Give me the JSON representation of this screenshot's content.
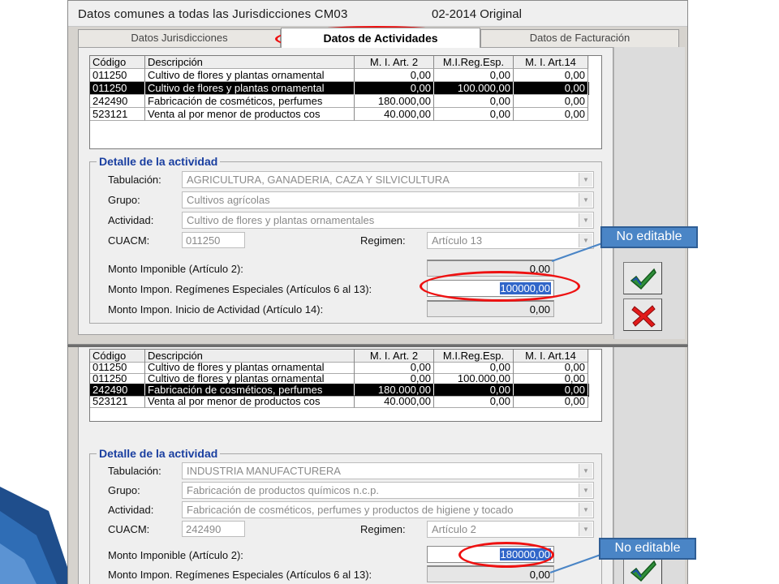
{
  "window1": {
    "title": "Datos comunes a todas las Jurisdicciones CM03",
    "period": "02-2014 Original",
    "tabs": [
      {
        "label": "Datos Jurisdicciones"
      },
      {
        "label": "Datos de Actividades"
      },
      {
        "label": "Datos de Facturación"
      }
    ],
    "grid": {
      "columns": [
        "Código",
        "Descripción",
        "M. I. Art. 2",
        "M.I.Reg.Esp.",
        "M. I. Art.14"
      ],
      "rows": [
        [
          "011250",
          "Cultivo de flores y plantas ornamental",
          "0,00",
          "0,00",
          "0,00"
        ],
        [
          "011250",
          "Cultivo de flores y plantas ornamental",
          "0,00",
          "100.000,00",
          "0,00"
        ],
        [
          "242490",
          "Fabricación de cosméticos, perfumes",
          "180.000,00",
          "0,00",
          "0,00"
        ],
        [
          "523121",
          "Venta al por menor de productos cos",
          "40.000,00",
          "0,00",
          "0,00"
        ]
      ],
      "selected_row": 1
    },
    "detail": {
      "legend": "Detalle de la actividad",
      "tabulacion_label": "Tabulación:",
      "tabulacion_value": "AGRICULTURA, GANADERIA, CAZA Y SILVICULTURA",
      "grupo_label": "Grupo:",
      "grupo_value": "Cultivos agrícolas",
      "actividad_label": "Actividad:",
      "actividad_value": "Cultivo de flores y plantas ornamentales",
      "cuacm_label": "CUACM:",
      "cuacm_value": "011250",
      "regimen_label": "Regimen:",
      "regimen_value": "Artículo 13",
      "monto_art2_label": "Monto Imponible (Artículo 2):",
      "monto_art2_value": "0,00",
      "monto_esp_label": "Monto Impon. Regímenes Especiales (Artículos 6 al 13):",
      "monto_esp_value": "100000,00",
      "monto_inicio_label": "Monto Impon. Inicio de Actividad (Artículo 14):",
      "monto_inicio_value": "0,00"
    }
  },
  "window2": {
    "grid": {
      "columns": [
        "Código",
        "Descripción",
        "M. I. Art. 2",
        "M.I.Reg.Esp.",
        "M. I. Art.14"
      ],
      "rows": [
        [
          "011250",
          "Cultivo de flores y plantas ornamental",
          "0,00",
          "0,00",
          "0,00"
        ],
        [
          "011250",
          "Cultivo de flores y plantas ornamental",
          "0,00",
          "100.000,00",
          "0,00"
        ],
        [
          "242490",
          "Fabricación de cosméticos, perfumes",
          "180.000,00",
          "0,00",
          "0,00"
        ],
        [
          "523121",
          "Venta al por menor de productos cos",
          "40.000,00",
          "0,00",
          "0,00"
        ]
      ],
      "selected_row": 2
    },
    "detail": {
      "legend": "Detalle de la actividad",
      "tabulacion_label": "Tabulación:",
      "tabulacion_value": "INDUSTRIA MANUFACTURERA",
      "grupo_label": "Grupo:",
      "grupo_value": "Fabricación de productos químicos n.c.p.",
      "actividad_label": "Actividad:",
      "actividad_value": "Fabricación de cosméticos, perfumes y productos de higiene y tocado",
      "cuacm_label": "CUACM:",
      "cuacm_value": "242490",
      "regimen_label": "Regimen:",
      "regimen_value": "Artículo 2",
      "monto_art2_label": "Monto Imponible (Artículo 2):",
      "monto_art2_value": "180000,00",
      "monto_esp_label": "Monto Impon. Regímenes Especiales (Artículos 6 al 13):",
      "monto_esp_value": "0,00"
    }
  },
  "callouts": {
    "top": "No editable",
    "bottom": "No editable"
  },
  "colors": {
    "legend_blue": "#1a3fa0",
    "highlight_red": "#ee1111",
    "callout_blue": "#4a85c6",
    "selection_blue": "#3166c9"
  },
  "icons": {
    "accept": "checkmark-icon",
    "cancel": "red-x-icon",
    "dropdown": "chevron-down-icon"
  }
}
